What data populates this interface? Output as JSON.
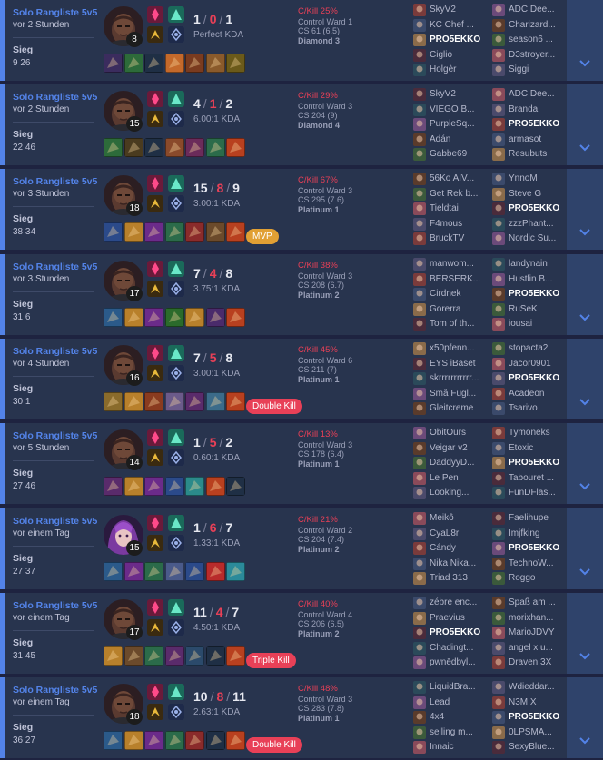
{
  "colors": {
    "background": "#1e2340",
    "card": "#28344e",
    "accent": "#5383e8",
    "loss": "#e84057",
    "mvp": "#e1a034",
    "expand": "#2f436b"
  },
  "matches": [
    {
      "queue": "Solo Rangliste 5v5",
      "ago": "vor 2 Stunden",
      "result": "Sieg",
      "duration": "9 26",
      "champion_icon": "dark-skinned-champion-portrait",
      "level": "8",
      "kills": "1",
      "deaths": "0",
      "assists": "1",
      "kda": "Perfect KDA",
      "pkill": "C/Kill 25%",
      "ward": "Control Ward 1",
      "cs": "CS 61 (6.5)",
      "rank": "Diamond 3",
      "badge": "",
      "badge_type": "",
      "team1": [
        "SkyV2",
        "KC Chef ...",
        "PRO5EKKO",
        "Ciglio",
        "Holgèr"
      ],
      "team2": [
        "ADC Dee...",
        "Charizard...",
        "season6 ...",
        "D3stroyer...",
        "Siggi"
      ],
      "me_team": 1,
      "me_index": 2,
      "items": [
        "item-1",
        "item-2",
        "item-3",
        "item-4",
        "item-5",
        "item-6",
        "item-7"
      ]
    },
    {
      "queue": "Solo Rangliste 5v5",
      "ago": "vor 2 Stunden",
      "result": "Sieg",
      "duration": "22 46",
      "champion_icon": "dark-skinned-champion-portrait",
      "level": "15",
      "kills": "4",
      "deaths": "1",
      "assists": "2",
      "kda": "6.00:1 KDA",
      "pkill": "C/Kill 29%",
      "ward": "Control Ward 3",
      "cs": "CS 204 (9)",
      "rank": "Diamond 4",
      "badge": "",
      "badge_type": "",
      "team1": [
        "SkyV2",
        "VIEGO B...",
        "PurpleSq...",
        "Adán",
        "Gabbe69"
      ],
      "team2": [
        "ADC Dee...",
        "Branda",
        "PRO5EKKO",
        "armasot",
        "Resubuts"
      ],
      "me_team": 2,
      "me_index": 2,
      "items": [
        "item-1",
        "item-2",
        "item-3",
        "item-4",
        "item-5",
        "item-6",
        "item-7"
      ]
    },
    {
      "queue": "Solo Rangliste 5v5",
      "ago": "vor 3 Stunden",
      "result": "Sieg",
      "duration": "38 34",
      "champion_icon": "dark-skinned-champion-portrait",
      "level": "18",
      "kills": "15",
      "deaths": "8",
      "assists": "9",
      "kda": "3.00:1 KDA",
      "pkill": "C/Kill 67%",
      "ward": "Control Ward 3",
      "cs": "CS 295 (7.6)",
      "rank": "Platinum 1",
      "badge": "MVP",
      "badge_type": "mvp",
      "team1": [
        "56Ko AIV...",
        "Get Rek b...",
        "Tieldtai",
        "F4mous",
        "BruckTV"
      ],
      "team2": [
        "YnnoM",
        "Steve G",
        "PRO5EKKO",
        "zzzPhant...",
        "Nordic Su..."
      ],
      "me_team": 2,
      "me_index": 2,
      "items": [
        "item-1",
        "item-2",
        "item-3",
        "item-4",
        "item-5",
        "item-6",
        "item-7"
      ]
    },
    {
      "queue": "Solo Rangliste 5v5",
      "ago": "vor 3 Stunden",
      "result": "Sieg",
      "duration": "31 6",
      "champion_icon": "dark-skinned-champion-portrait",
      "level": "17",
      "kills": "7",
      "deaths": "4",
      "assists": "8",
      "kda": "3.75:1 KDA",
      "pkill": "C/Kill 38%",
      "ward": "Control Ward 3",
      "cs": "CS 208 (6.7)",
      "rank": "Platinum 2",
      "badge": "",
      "badge_type": "",
      "team1": [
        "manwom...",
        "BERSERK...",
        "Cirdnek",
        "Gorerra",
        "Tom of th..."
      ],
      "team2": [
        "landynain",
        "Hustlin B...",
        "PRO5EKKO",
        "RuSeK",
        "iousai"
      ],
      "me_team": 2,
      "me_index": 2,
      "items": [
        "item-1",
        "item-2",
        "item-3",
        "item-4",
        "item-5",
        "item-6",
        "item-7"
      ]
    },
    {
      "queue": "Solo Rangliste 5v5",
      "ago": "vor 4 Stunden",
      "result": "Sieg",
      "duration": "30 1",
      "champion_icon": "dark-skinned-champion-portrait",
      "level": "16",
      "kills": "7",
      "deaths": "5",
      "assists": "8",
      "kda": "3.00:1 KDA",
      "pkill": "C/Kill 45%",
      "ward": "Control Ward 6",
      "cs": "CS 211 (7)",
      "rank": "Platinum 1",
      "badge": "Double Kill",
      "badge_type": "multi",
      "team1": [
        "x50pfenn...",
        "EYS iBaset",
        "skrrrrrrrrrrr...",
        "Små Fugl...",
        "Gleitcreme"
      ],
      "team2": [
        "stopacta2",
        "Jacor0901",
        "PRO5EKKO",
        "Acadeon",
        "Tsarivo"
      ],
      "me_team": 2,
      "me_index": 2,
      "items": [
        "item-1",
        "item-2",
        "item-3",
        "item-4",
        "item-5",
        "item-6",
        "item-7"
      ]
    },
    {
      "queue": "Solo Rangliste 5v5",
      "ago": "vor 5 Stunden",
      "result": "Sieg",
      "duration": "27 46",
      "champion_icon": "dark-skinned-champion-portrait",
      "level": "14",
      "kills": "1",
      "deaths": "5",
      "assists": "2",
      "kda": "0.60:1 KDA",
      "pkill": "C/Kill 13%",
      "ward": "Control Ward 3",
      "cs": "CS 178 (6.4)",
      "rank": "Platinum 1",
      "badge": "",
      "badge_type": "",
      "team1": [
        "ObitOurs",
        "Veigar v2",
        "DaddyyD...",
        "Le Pen",
        "Looking..."
      ],
      "team2": [
        "Tymoneks",
        "Etoxic",
        "PRO5EKKO",
        "Tabouret ...",
        "FunDFlas..."
      ],
      "me_team": 2,
      "me_index": 2,
      "items": [
        "item-1",
        "item-2",
        "item-3",
        "item-4",
        "item-5",
        "item-6",
        "item-7"
      ]
    },
    {
      "queue": "Solo Rangliste 5v5",
      "ago": "vor einem Tag",
      "result": "Sieg",
      "duration": "27 37",
      "champion_icon": "purple-haired-champion-portrait",
      "level": "15",
      "kills": "1",
      "deaths": "6",
      "assists": "7",
      "kda": "1.33:1 KDA",
      "pkill": "C/Kill 21%",
      "ward": "Control Ward 2",
      "cs": "CS 204 (7.4)",
      "rank": "Platinum 2",
      "badge": "",
      "badge_type": "",
      "team1": [
        "Meikô",
        "CyaL8r",
        "Cándy",
        "Nika Nika...",
        "Triad 313"
      ],
      "team2": [
        "Faelihupe",
        "Imjfking",
        "PRO5EKKO",
        "TechnoW...",
        "Roggo"
      ],
      "me_team": 2,
      "me_index": 2,
      "items": [
        "item-1",
        "item-2",
        "item-3",
        "item-4",
        "item-5",
        "item-6",
        "item-7"
      ]
    },
    {
      "queue": "Solo Rangliste 5v5",
      "ago": "vor einem Tag",
      "result": "Sieg",
      "duration": "31 45",
      "champion_icon": "dark-skinned-champion-portrait",
      "level": "17",
      "kills": "11",
      "deaths": "4",
      "assists": "7",
      "kda": "4.50:1 KDA",
      "pkill": "C/Kill 40%",
      "ward": "Control Ward 4",
      "cs": "CS 206 (6.5)",
      "rank": "Platinum 2",
      "badge": "Triple Kill",
      "badge_type": "multi",
      "team1": [
        "zébre enc...",
        "Praevius",
        "PRO5EKKO",
        "Chadingt...",
        "pwnēdbyl..."
      ],
      "team2": [
        "Spaß am ...",
        "morixhan...",
        "MarioJDVY",
        "angel x u...",
        "Draven 3X"
      ],
      "me_team": 1,
      "me_index": 2,
      "items": [
        "item-1",
        "item-2",
        "item-3",
        "item-4",
        "item-5",
        "item-6",
        "item-7"
      ]
    },
    {
      "queue": "Solo Rangliste 5v5",
      "ago": "vor einem Tag",
      "result": "Sieg",
      "duration": "36 27",
      "champion_icon": "dark-skinned-champion-portrait",
      "level": "18",
      "kills": "10",
      "deaths": "8",
      "assists": "11",
      "kda": "2.63:1 KDA",
      "pkill": "C/Kill 48%",
      "ward": "Control Ward 3",
      "cs": "CS 283 (7.8)",
      "rank": "Platinum 1",
      "badge": "Double Kill",
      "badge_type": "multi",
      "team1": [
        "LiquidBra...",
        "Leaď",
        "4x4",
        "selling m...",
        "Innaic"
      ],
      "team2": [
        "Wdieddar...",
        "N3MIX",
        "PRO5EKKO",
        "0LPSMA...",
        "SexyBlue..."
      ],
      "me_team": 2,
      "me_index": 2,
      "items": [
        "item-1",
        "item-2",
        "item-3",
        "item-4",
        "item-5",
        "item-6",
        "item-7"
      ]
    }
  ]
}
